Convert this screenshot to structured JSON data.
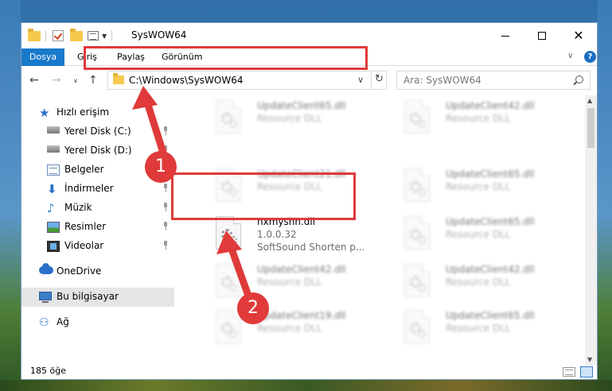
{
  "window": {
    "title": "SysWOW64",
    "controls": {
      "minimize": "",
      "maximize": "",
      "close": "✕"
    }
  },
  "ribbon": {
    "tabs": [
      "Dosya",
      "Giriş",
      "Paylaş",
      "Görünüm"
    ],
    "help": "?"
  },
  "address_bar": {
    "path": "C:\\Windows\\SysWOW64"
  },
  "search": {
    "placeholder": "Ara: SysWOW64"
  },
  "nav_pane": {
    "items": [
      {
        "label": "Hızlı erişim",
        "icon": "star-icon",
        "pinned": false
      },
      {
        "label": "Yerel Disk (C:)",
        "icon": "drive-icon",
        "pinned": true
      },
      {
        "label": "Yerel Disk (D:)",
        "icon": "drive-icon",
        "pinned": true
      },
      {
        "label": "Belgeler",
        "icon": "documents-icon",
        "pinned": true
      },
      {
        "label": "İndirmeler",
        "icon": "download-icon",
        "pinned": true
      },
      {
        "label": "Müzik",
        "icon": "music-icon",
        "pinned": true
      },
      {
        "label": "Resimler",
        "icon": "pictures-icon",
        "pinned": true
      },
      {
        "label": "Videolar",
        "icon": "videos-icon",
        "pinned": true
      },
      {
        "label": "OneDrive",
        "icon": "cloud-icon",
        "pinned": false
      },
      {
        "label": "Bu bilgisayar",
        "icon": "computer-icon",
        "pinned": false,
        "selected": true
      },
      {
        "label": "Ağ",
        "icon": "network-icon",
        "pinned": false
      }
    ]
  },
  "files": [
    {
      "name": "UpdateClient65.dll",
      "desc": "Resource DLL",
      "blurred": true
    },
    {
      "name": "UpdateClient42.dll",
      "desc": "Resource DLL",
      "blurred": true
    },
    {
      "name": "UpdateClient21.dll",
      "desc": "Resource DLL",
      "blurred": true
    },
    {
      "name": "UpdateClient65.dll",
      "desc": "Resource DLL",
      "blurred": true
    },
    {
      "name": "nxmyshn.dll",
      "desc": "1.0.0.32",
      "desc2": "SoftSound Shorten p...",
      "blurred": false
    },
    {
      "name": "UpdateClient65.dll",
      "desc": "Resource DLL",
      "blurred": true
    },
    {
      "name": "UpdateClient42.dll",
      "desc": "Resource DLL",
      "blurred": true
    },
    {
      "name": "UpdateClient42.dll",
      "desc": "Resource DLL",
      "blurred": true
    },
    {
      "name": "UpdateClient19.dll",
      "desc": "Resource DLL",
      "blurred": true
    },
    {
      "name": "UpdateClient65.dll",
      "desc": "Resource DLL",
      "blurred": true
    }
  ],
  "status": {
    "count": "185 öğe"
  },
  "annotations": {
    "badge1": "1",
    "badge2": "2",
    "color": "#e03a3a"
  }
}
